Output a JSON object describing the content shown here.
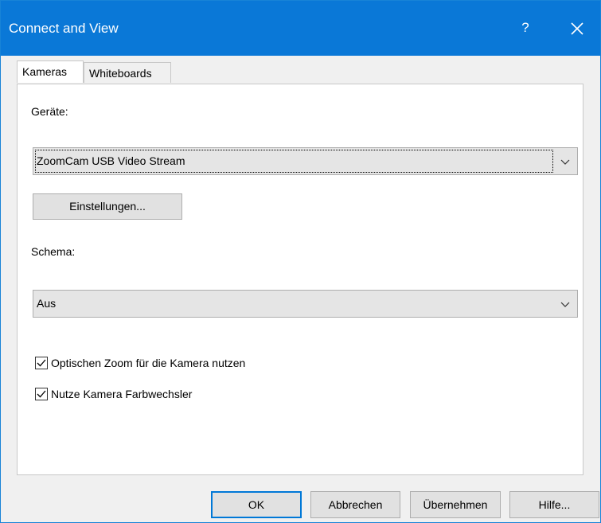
{
  "window": {
    "title": "Connect and View",
    "help_glyph": "?",
    "close_icon": "close-icon"
  },
  "tabs": [
    {
      "label": "Kameras",
      "active": true
    },
    {
      "label": "Whiteboards",
      "active": false
    }
  ],
  "devices": {
    "label": "Geräte:",
    "selected": "ZoomCam USB Video Stream",
    "settings_button": "Einstellungen..."
  },
  "scheme": {
    "label": "Schema:",
    "selected": "Aus"
  },
  "options": [
    {
      "label": "Optischen Zoom für die Kamera nutzen",
      "checked": true
    },
    {
      "label": "Nutze Kamera Farbwechsler",
      "checked": true
    }
  ],
  "buttons": {
    "ok": "OK",
    "cancel": "Abbrechen",
    "apply": "Übernehmen",
    "help": "Hilfe..."
  },
  "colors": {
    "titlebar": "#0a78d7",
    "default_button_border": "#0078d7"
  }
}
